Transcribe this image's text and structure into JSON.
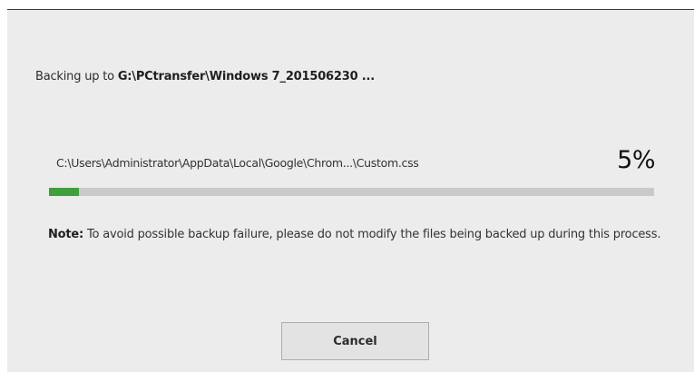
{
  "dialog": {
    "backing_up_prefix": "Backing up to ",
    "backing_up_path": "G:\\PCtransfer\\Windows 7_201506230 ...",
    "current_file": "C:\\Users\\Administrator\\AppData\\Local\\Google\\Chrom...\\Custom.css",
    "progress_percent_label": "5%",
    "progress_fraction": 0.05,
    "note_label": "Note:",
    "note_text": " To avoid possible backup failure, please do not modify the files being backed up during this process.",
    "cancel_label": "Cancel"
  },
  "colors": {
    "progress_fill": "#3f9f3d",
    "progress_track": "#c9c9c9",
    "dialog_background": "#ececec"
  }
}
